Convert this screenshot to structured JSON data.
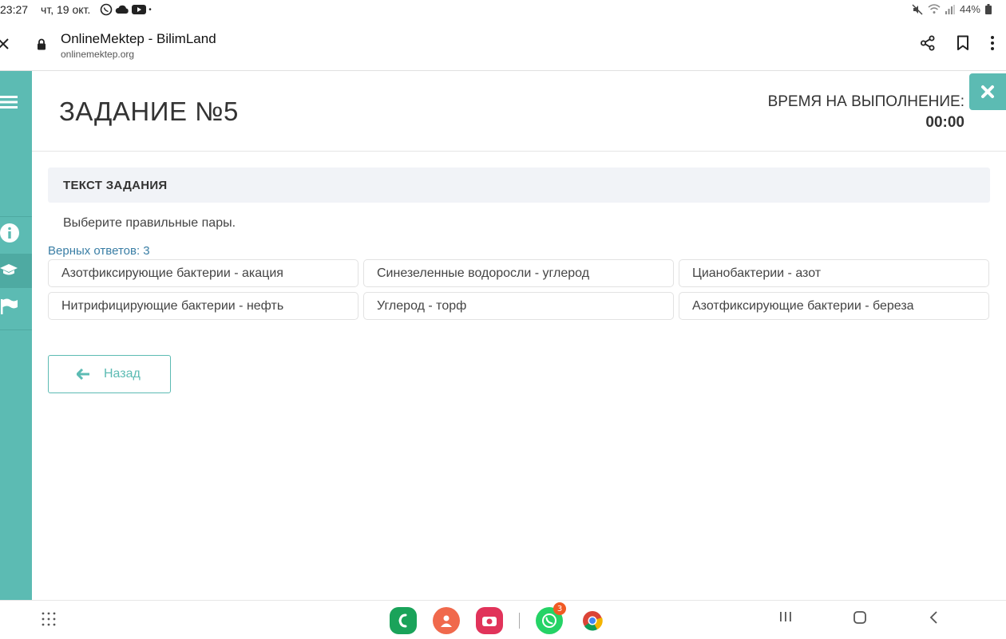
{
  "status_bar": {
    "time": "23:27",
    "date": "чт, 19 окт.",
    "battery": "44%"
  },
  "browser": {
    "title": "OnlineMektep - BilimLand",
    "url": "onlinemektep.org"
  },
  "task": {
    "title": "ЗАДАНИЕ №5",
    "timer_label": "ВРЕМЯ НА ВЫПОЛНЕНИЕ:",
    "timer_value": "00:00",
    "text_heading": "ТЕКСТ ЗАДАНИЯ",
    "instruction": "Выберите правильные пары.",
    "correct_count": "Верных ответов: 3",
    "options": [
      "Азотфиксирующие бактерии - акация",
      "Синезеленные водоросли - углерод",
      "Цианобактерии - азот",
      "Нитрифицирующие бактерии - нефть",
      "Углерод - торф",
      "Азотфиксирующие бактерии - береза"
    ],
    "back_label": "Назад"
  },
  "sidebar_icons": [
    "menu-icon",
    "info-icon",
    "graduation-cap-icon",
    "flag-icon"
  ],
  "dock": {
    "whatsapp_badge": "3"
  },
  "colors": {
    "accent": "#5cbbb3",
    "link": "#3a7ea5",
    "panel": "#f1f3f7"
  }
}
